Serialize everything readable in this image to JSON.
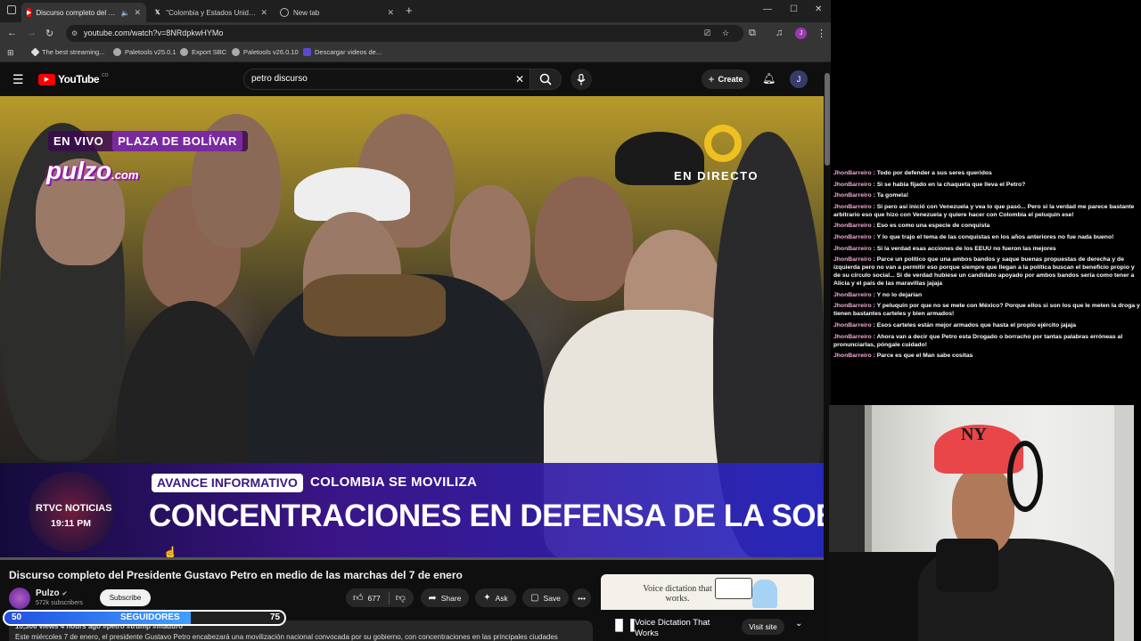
{
  "browser": {
    "tabs": [
      {
        "label": "Discurso completo del Presidente Gustavo Petro",
        "icon": "youtube-favicon",
        "active": true,
        "muted": true
      },
      {
        "label": "\"Colombia y Estados Unidos\" -",
        "icon": "x-favicon",
        "active": false
      },
      {
        "label": "New tab",
        "icon": "globe-favicon",
        "active": false
      }
    ],
    "new_tab_symbol": "+",
    "url": "youtube.com/watch?v=8NRdpkwHYMo",
    "profile_initial": "J",
    "bookmarks": [
      {
        "label": "The best streaming..."
      },
      {
        "label": "Paletools v25.0.1"
      },
      {
        "label": "Export SBC"
      },
      {
        "label": "Paletools v26.0.10"
      },
      {
        "label": "Descargar videos de..."
      }
    ]
  },
  "youtube": {
    "logo_text": "YouTube",
    "logo_country": "CO",
    "search_value": "petro discurso",
    "create_label": "Create",
    "avatar_initial": "J"
  },
  "video": {
    "overlay_live": "EN VIVO",
    "overlay_place": "PLAZA DE BOLÍVAR",
    "overlay_brand": "pulzo",
    "overlay_brand_suffix": ".com",
    "overlay_en_directo": "EN DIRECTO",
    "lower_third_tag": "AVANCE INFORMATIVO",
    "lower_third_kicker": "COLOMBIA SE MOVILIZA",
    "lower_third_headline": "CONCENTRACIONES EN DEFENSA DE LA SOBERANÍA",
    "network_name": "RTVC NOTICIAS",
    "network_time": "19:11 PM",
    "progress": 0.0,
    "title": "Discurso completo del Presidente Gustavo Petro en medio de las marchas del 7 de enero"
  },
  "channel": {
    "name": "Pulzo",
    "subscribers": "572k subscribers",
    "subscribe_label": "Subscribe"
  },
  "actions": {
    "like_count": "677",
    "share_label": "Share",
    "ask_label": "Ask",
    "save_label": "Save"
  },
  "ad": {
    "card_text": "Voice dictation that works.",
    "title": "Voice Dictation That Works",
    "visit_label": "Visit site"
  },
  "overlay_goal": {
    "left_value": "50",
    "label": "SEGUIDORES",
    "right_value": "75",
    "fill": 0.667
  },
  "description": {
    "views_line": "10,306 views  4 hours ago  #petro #trump #maduro",
    "text": "Este miércoles 7 de enero, el presidente Gustavo Petro encabezará una movilización nacional convocada por su gobierno, con concentraciones en las principales ciudades"
  },
  "chat": {
    "messages": [
      {
        "user": "JhonBarreiro",
        "text": "Todo por defender a sus seres queridos"
      },
      {
        "user": "JhonBarreiro",
        "text": "Si se habia fijado en la chaqueta que lleva el Petro?"
      },
      {
        "user": "JhonBarreiro",
        "text": "Ta gomela!"
      },
      {
        "user": "JhonBarreiro",
        "text": "Si pero así inició con Venezuela y vea lo que pasó... Pero si la verdad me parece bastante arbitrario eso que hizo con Venezuela y quiere hacer con Colombia el peluquin ese!"
      },
      {
        "user": "JhonBarreiro",
        "text": "Eso es como una especie de conquista"
      },
      {
        "user": "JhonBarreiro",
        "text": "Y lo que trajo el tema de las conquistas en los años anteriores no fue nada bueno!"
      },
      {
        "user": "JhonBarreiro",
        "text": "Si la verdad esas acciones de los EEUU no fueron las mejores"
      },
      {
        "user": "JhonBarreiro",
        "text": "Parce un político que una ambos bandos y saque buenas propuestas de derecha y de izquierda pero no van a permitir eso porque siempre que llegan a la política buscan el beneficio propio y de su círculo social... Si de verdad hubiese un candidato apoyado por ambos bandos sería como tener a Alicia y el país de las maravillas jajaja"
      },
      {
        "user": "JhonBarreiro",
        "text": "Y no lo dejarían"
      },
      {
        "user": "JhonBarreiro",
        "text": "Y peluquín por que no se mete con México? Porque ellos si son los que le meten la droga y tienen bastantes carteles y bien armados!"
      },
      {
        "user": "JhonBarreiro",
        "text": "Esos carteles están mejor armados que hasta el propio ejército jajaja"
      },
      {
        "user": "JhonBarreiro",
        "text": "Ahora van a decir que Petro esta Drogado o borracho por tantas palabras erróneas al pronunciarlas, póngale cuidado!"
      },
      {
        "user": "JhonBarreiro",
        "text": "Parce es que el Man sabe cositas"
      }
    ]
  },
  "colors": {
    "youtube_red": "#ff0000",
    "chat_username": "#f5a9d8",
    "goal_fill": "#2f7bff"
  }
}
